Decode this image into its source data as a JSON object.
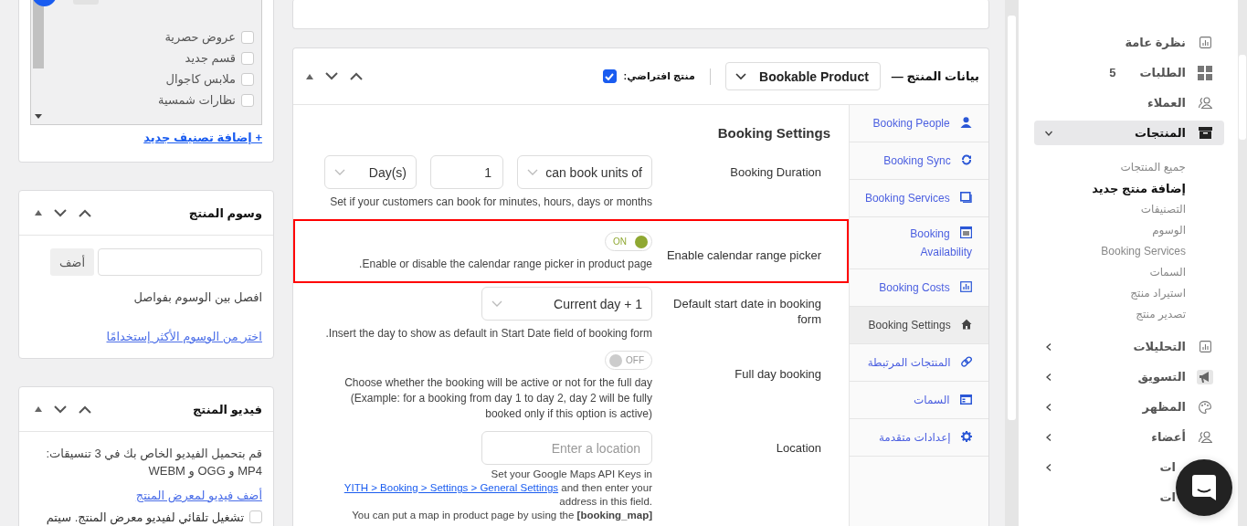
{
  "categories": {
    "items": [
      {
        "label": "عروض حصرية",
        "checked": false
      },
      {
        "label": "قسم جديد",
        "checked": false
      },
      {
        "label": "ملابس كاجوال",
        "checked": false
      },
      {
        "label": "نظارات شمسية",
        "checked": false
      }
    ],
    "add_link": "+ إضافة تصنيف جديد"
  },
  "tags_box": {
    "title": "وسوم المنتج",
    "button": "أضف",
    "hint": "افصل بين الوسوم بفواصل",
    "link": "اختر من الوسوم الأكثر إستخدامًا"
  },
  "video_box": {
    "title": "فيديو المنتج",
    "text": "قم بتحميل الفيديو الخاص بك في 3 تنسيقات: MP4 و OGG و WEBM",
    "link": "أضف فيديو لمعرض المنتج",
    "autoplay": {
      "label": "تشغيل تلقائي لفيديو معرض المنتج. سيتم",
      "checked": false
    }
  },
  "product_data": {
    "title": "بيانات المنتج —",
    "product_type": "Bookable Product",
    "virtual": {
      "label": "منتج افتراضي:",
      "checked": true
    },
    "tabs": [
      {
        "label": "Booking People",
        "selected": false
      },
      {
        "label": "Booking Sync",
        "selected": false
      },
      {
        "label": "Booking Services",
        "selected": false
      },
      {
        "label": "Booking Availability",
        "selected": false
      },
      {
        "label": "Booking Costs",
        "selected": false
      },
      {
        "label": "Booking Settings",
        "selected": true
      },
      {
        "label": "المنتجات المرتبطة",
        "selected": false
      },
      {
        "label": "السمات",
        "selected": false
      },
      {
        "label": "إعدادات متقدمة",
        "selected": false
      }
    ],
    "section_title": "Booking Settings",
    "settings": [
      {
        "kind": "duration",
        "label": "Booking Duration",
        "highlighted": false,
        "unit_select": "can book units of",
        "amount": "1",
        "period_select": "Day(s)",
        "description": "Set if your customers can book for minutes, hours, days or months"
      },
      {
        "kind": "toggle",
        "label": "Enable calendar range picker",
        "highlighted": true,
        "on": true,
        "toggle_text": "ON",
        "description": "Enable or disable the calendar range picker in product page."
      },
      {
        "kind": "select",
        "label": "Default start date in booking form",
        "highlighted": false,
        "value": "Current day + 1",
        "description": "Insert the day to show as default in Start Date field of booking form."
      },
      {
        "kind": "toggle",
        "label": "Full day booking",
        "highlighted": false,
        "on": false,
        "toggle_text": "OFF",
        "description": "Choose whether the booking will be active or not for the full day (Example: for a booking from day 1 to day 2, day 2 will be fully booked only if this option is active)"
      },
      {
        "kind": "location",
        "label": "Location",
        "highlighted": false,
        "placeholder": "Enter a location",
        "description_before": "Set your Google Maps API Keys in",
        "link": "YITH > Booking > Settings > General Settings",
        "description_after": "and then enter your address in this field.",
        "note": "You can put a map in product page by using the **[booking_map]**"
      }
    ]
  },
  "sidebar": {
    "items": [
      {
        "label": "نظرة عامة",
        "selected": false
      },
      {
        "label": "الطلبات",
        "badge": "5",
        "selected": false
      },
      {
        "label": "العملاء",
        "selected": false
      },
      {
        "label": "المنتجات",
        "selected": true,
        "expanded": true,
        "children": [
          {
            "label": "جميع المنتجات",
            "selected": false
          },
          {
            "label": "إضافة منتج جديد",
            "selected": true
          },
          {
            "label": "التصنيفات",
            "selected": false
          },
          {
            "label": "الوسوم",
            "selected": false
          },
          {
            "label": "Booking Services",
            "selected": false
          },
          {
            "label": "السمات",
            "selected": false
          },
          {
            "label": "استيراد منتج",
            "selected": false
          },
          {
            "label": "تصدير منتج",
            "selected": false
          }
        ]
      },
      {
        "label": "التحليلات",
        "selected": false,
        "expanded": false
      },
      {
        "label": "التسويق",
        "selected": false,
        "expanded": false
      },
      {
        "label": "المظهر",
        "selected": false,
        "expanded": false
      },
      {
        "label": "أعضاء",
        "selected": false,
        "expanded": false
      },
      {
        "label": "ات",
        "selected": false,
        "expanded": false
      },
      {
        "label": "ات",
        "selected": false
      }
    ]
  }
}
